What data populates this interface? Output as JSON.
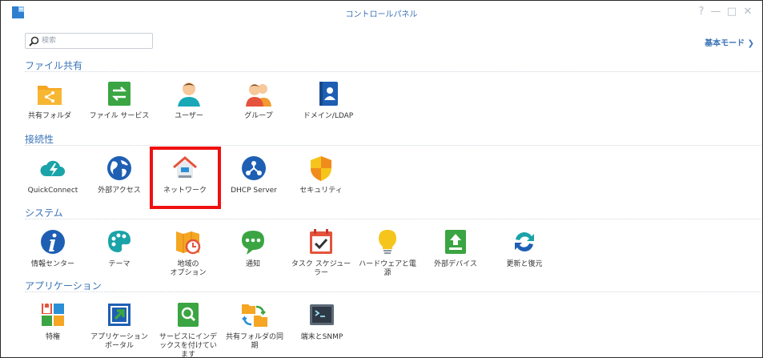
{
  "window": {
    "title": "コントロールパネル",
    "controls": {
      "help": "?",
      "minimize": "—",
      "maximize": "□",
      "close": "✕"
    }
  },
  "search": {
    "placeholder": "検索"
  },
  "mode_link": "基本モード ❯",
  "sections": [
    {
      "title": "ファイル共有",
      "items": [
        {
          "label": "共有フォルダ",
          "icon": "shared-folder-icon"
        },
        {
          "label": "ファイル サービス",
          "icon": "file-services-icon"
        },
        {
          "label": "ユーザー",
          "icon": "user-icon"
        },
        {
          "label": "グループ",
          "icon": "group-icon"
        },
        {
          "label": "ドメイン/LDAP",
          "icon": "domain-ldap-icon"
        }
      ]
    },
    {
      "title": "接続性",
      "items": [
        {
          "label": "QuickConnect",
          "icon": "quickconnect-icon"
        },
        {
          "label": "外部アクセス",
          "icon": "external-access-icon"
        },
        {
          "label": "ネットワーク",
          "icon": "network-icon"
        },
        {
          "label": "DHCP Server",
          "icon": "dhcp-server-icon"
        },
        {
          "label": "セキュリティ",
          "icon": "security-icon"
        }
      ]
    },
    {
      "title": "システム",
      "items": [
        {
          "label": "情報センター",
          "icon": "info-center-icon"
        },
        {
          "label": "テーマ",
          "icon": "theme-icon"
        },
        {
          "label": "地域の\nオプション",
          "icon": "regional-options-icon"
        },
        {
          "label": "通知",
          "icon": "notification-icon"
        },
        {
          "label": "タスク スケジュー\nラー",
          "icon": "task-scheduler-icon"
        },
        {
          "label": "ハードウェアと電\n源",
          "icon": "hardware-power-icon"
        },
        {
          "label": "外部デバイス",
          "icon": "external-devices-icon"
        },
        {
          "label": "更新と復元",
          "icon": "update-restore-icon"
        }
      ]
    },
    {
      "title": "アプリケーション",
      "items": [
        {
          "label": "特権",
          "icon": "privileges-icon"
        },
        {
          "label": "アプリケーション\nポータル",
          "icon": "application-portal-icon"
        },
        {
          "label": "サービスにインデ\nックスを付けてい\nます",
          "icon": "indexing-service-icon"
        },
        {
          "label": "共有フォルダの同\n期",
          "icon": "shared-folder-sync-icon"
        },
        {
          "label": "端末とSNMP",
          "icon": "terminal-snmp-icon"
        }
      ]
    }
  ],
  "colors": {
    "accent": "#3a73b8",
    "highlight": "#ef1010"
  }
}
